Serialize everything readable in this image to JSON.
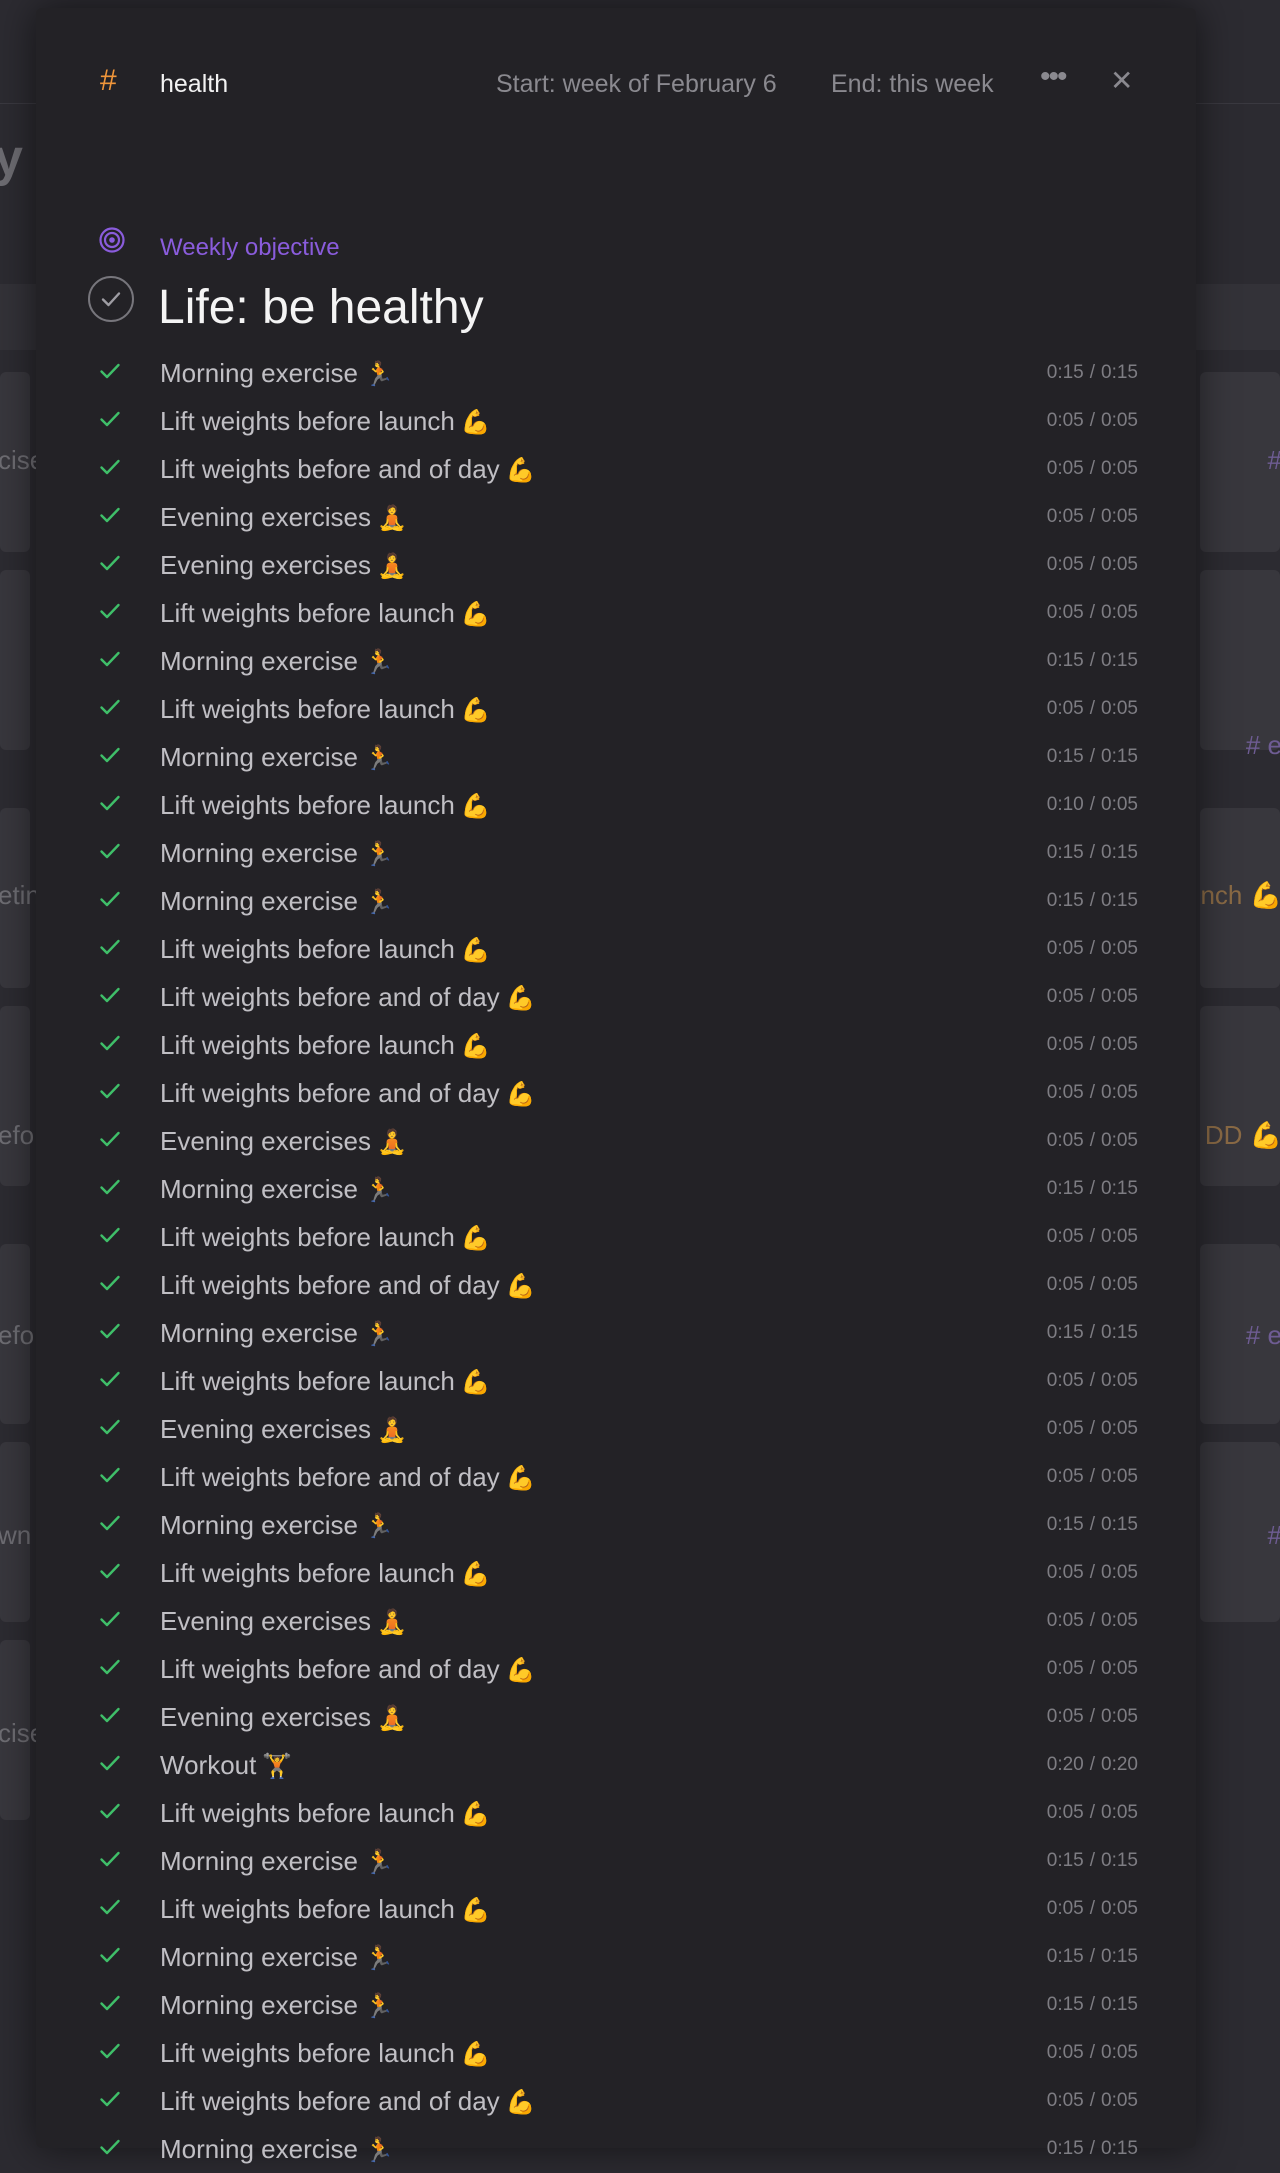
{
  "background": {
    "title_fragment": "y",
    "snippets": [
      {
        "text": "cise",
        "side": "left",
        "row": 0
      },
      {
        "text": "#",
        "side": "right",
        "row": 0
      },
      {
        "text": "# e",
        "side": "right",
        "row": 1
      },
      {
        "text": "etin",
        "side": "left",
        "row": 2
      },
      {
        "text": "nch 💪",
        "side": "right",
        "row": 2
      },
      {
        "text": "efo",
        "side": "left",
        "row": 3
      },
      {
        "text": "DD 💪",
        "side": "right",
        "row": 3
      },
      {
        "text": "efo",
        "side": "left",
        "row": 4
      },
      {
        "text": "# e",
        "side": "right",
        "row": 4
      },
      {
        "text": "wn",
        "side": "left",
        "row": 5
      },
      {
        "text": "#",
        "side": "right",
        "row": 5
      },
      {
        "text": "cise",
        "side": "left",
        "row": 6
      }
    ]
  },
  "header": {
    "hash_icon": "hash-icon",
    "tag_name": "health",
    "start_label": "Start: week of February 6",
    "end_label": "End: this week",
    "more_icon": "ellipsis-icon",
    "close_icon": "close-icon"
  },
  "objective": {
    "label": "Weekly objective",
    "title": "Life: be healthy",
    "accent": "#8a5cdc"
  },
  "colors": {
    "check": "#3fbf69",
    "tag": "#f0963a"
  },
  "tasks": [
    {
      "label": "Morning exercise",
      "emoji": "🏃",
      "actual": "0:15",
      "planned": "0:15"
    },
    {
      "label": "Lift weights before launch",
      "emoji": "💪",
      "actual": "0:05",
      "planned": "0:05"
    },
    {
      "label": "Lift weights before and of day",
      "emoji": "💪",
      "actual": "0:05",
      "planned": "0:05"
    },
    {
      "label": "Evening exercises",
      "emoji": "🧘",
      "actual": "0:05",
      "planned": "0:05"
    },
    {
      "label": "Evening exercises",
      "emoji": "🧘",
      "actual": "0:05",
      "planned": "0:05"
    },
    {
      "label": "Lift weights before launch",
      "emoji": "💪",
      "actual": "0:05",
      "planned": "0:05"
    },
    {
      "label": "Morning exercise",
      "emoji": "🏃",
      "actual": "0:15",
      "planned": "0:15"
    },
    {
      "label": "Lift weights before launch",
      "emoji": "💪",
      "actual": "0:05",
      "planned": "0:05"
    },
    {
      "label": "Morning exercise",
      "emoji": "🏃",
      "actual": "0:15",
      "planned": "0:15"
    },
    {
      "label": "Lift weights before launch",
      "emoji": "💪",
      "actual": "0:10",
      "planned": "0:05"
    },
    {
      "label": "Morning exercise",
      "emoji": "🏃",
      "actual": "0:15",
      "planned": "0:15"
    },
    {
      "label": "Morning exercise",
      "emoji": "🏃",
      "actual": "0:15",
      "planned": "0:15"
    },
    {
      "label": "Lift weights before launch",
      "emoji": "💪",
      "actual": "0:05",
      "planned": "0:05"
    },
    {
      "label": "Lift weights before and of day",
      "emoji": "💪",
      "actual": "0:05",
      "planned": "0:05"
    },
    {
      "label": "Lift weights before launch",
      "emoji": "💪",
      "actual": "0:05",
      "planned": "0:05"
    },
    {
      "label": "Lift weights before and of day",
      "emoji": "💪",
      "actual": "0:05",
      "planned": "0:05"
    },
    {
      "label": "Evening exercises",
      "emoji": "🧘",
      "actual": "0:05",
      "planned": "0:05"
    },
    {
      "label": "Morning exercise",
      "emoji": "🏃",
      "actual": "0:15",
      "planned": "0:15"
    },
    {
      "label": "Lift weights before launch",
      "emoji": "💪",
      "actual": "0:05",
      "planned": "0:05"
    },
    {
      "label": "Lift weights before and of day",
      "emoji": "💪",
      "actual": "0:05",
      "planned": "0:05"
    },
    {
      "label": "Morning exercise",
      "emoji": "🏃",
      "actual": "0:15",
      "planned": "0:15"
    },
    {
      "label": "Lift weights before launch",
      "emoji": "💪",
      "actual": "0:05",
      "planned": "0:05"
    },
    {
      "label": "Evening exercises",
      "emoji": "🧘",
      "actual": "0:05",
      "planned": "0:05"
    },
    {
      "label": "Lift weights before and of day",
      "emoji": "💪",
      "actual": "0:05",
      "planned": "0:05"
    },
    {
      "label": "Morning exercise",
      "emoji": "🏃",
      "actual": "0:15",
      "planned": "0:15"
    },
    {
      "label": "Lift weights before launch",
      "emoji": "💪",
      "actual": "0:05",
      "planned": "0:05"
    },
    {
      "label": "Evening exercises",
      "emoji": "🧘",
      "actual": "0:05",
      "planned": "0:05"
    },
    {
      "label": "Lift weights before and of day",
      "emoji": "💪",
      "actual": "0:05",
      "planned": "0:05"
    },
    {
      "label": "Evening exercises",
      "emoji": "🧘",
      "actual": "0:05",
      "planned": "0:05"
    },
    {
      "label": "Workout",
      "emoji": "🏋️",
      "actual": "0:20",
      "planned": "0:20"
    },
    {
      "label": "Lift weights before launch",
      "emoji": "💪",
      "actual": "0:05",
      "planned": "0:05"
    },
    {
      "label": "Morning exercise",
      "emoji": "🏃",
      "actual": "0:15",
      "planned": "0:15"
    },
    {
      "label": "Lift weights before launch",
      "emoji": "💪",
      "actual": "0:05",
      "planned": "0:05"
    },
    {
      "label": "Morning exercise",
      "emoji": "🏃",
      "actual": "0:15",
      "planned": "0:15"
    },
    {
      "label": "Morning exercise",
      "emoji": "🏃",
      "actual": "0:15",
      "planned": "0:15"
    },
    {
      "label": "Lift weights before launch",
      "emoji": "💪",
      "actual": "0:05",
      "planned": "0:05"
    },
    {
      "label": "Lift weights before and of day",
      "emoji": "💪",
      "actual": "0:05",
      "planned": "0:05"
    },
    {
      "label": "Morning exercise",
      "emoji": "🏃",
      "actual": "0:15",
      "planned": "0:15"
    }
  ]
}
